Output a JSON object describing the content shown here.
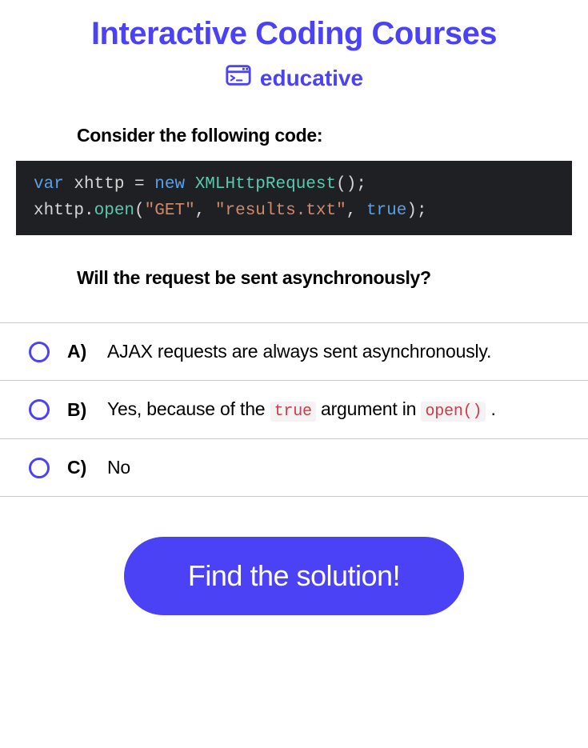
{
  "header": {
    "title": "Interactive Coding Courses",
    "brand": "educative"
  },
  "prompt": "Consider the following code:",
  "code": {
    "var_kw": "var",
    "ident": "xhttp",
    "eq": "=",
    "new_kw": "new",
    "ctor": "XMLHttpRequest",
    "open_call": "open",
    "arg1": "\"GET\"",
    "arg2": "\"results.txt\"",
    "arg3": "true"
  },
  "question": "Will the request be sent asynchronously?",
  "options": [
    {
      "letter": "A)",
      "text_plain": "AJAX requests are always sent asynchronously."
    },
    {
      "letter": "B)",
      "pre": "Yes, because of the ",
      "code1": "true",
      "mid": " argument in ",
      "code2": "open()",
      "post": " ."
    },
    {
      "letter": "C)",
      "text_plain": "No"
    }
  ],
  "cta": "Find the solution!"
}
